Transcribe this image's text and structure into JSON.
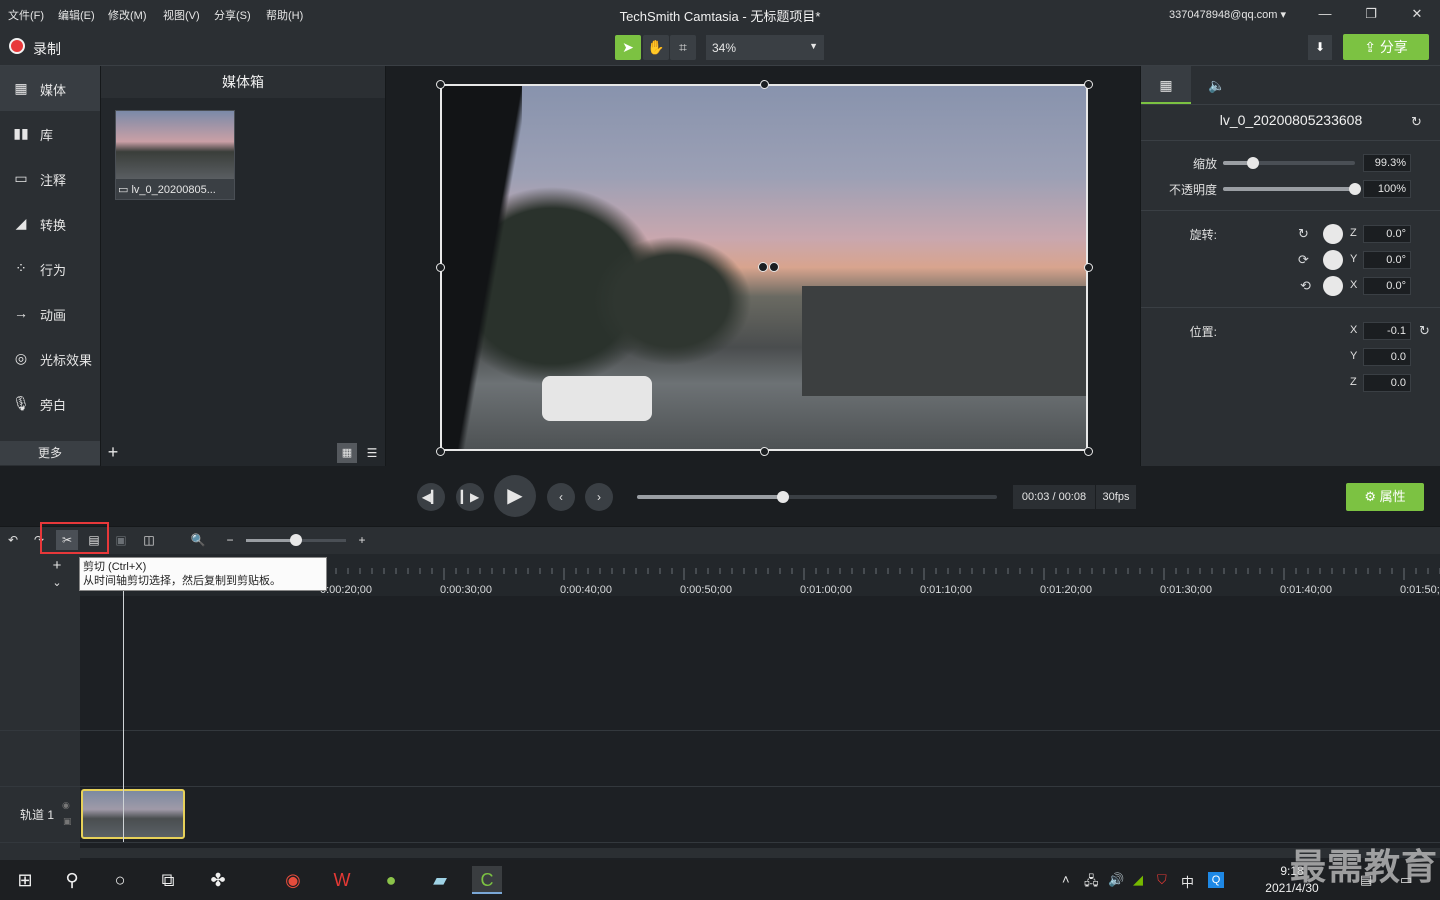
{
  "menu": [
    "文件(F)",
    "编辑(E)",
    "修改(M)",
    "视图(V)",
    "分享(S)",
    "帮助(H)"
  ],
  "window_title": "TechSmith Camtasia - 无标题项目*",
  "account": "3370478948@qq.com ▾",
  "record_label": "录制",
  "zoom_level": "34%",
  "share_label": "分享",
  "nav": [
    "媒体",
    "库",
    "注释",
    "转换",
    "行为",
    "动画",
    "光标效果",
    "旁白"
  ],
  "more_label": "更多",
  "media_bin": {
    "title": "媒体箱",
    "clip_label": "lv_0_20200805..."
  },
  "properties": {
    "clip_name": "lv_0_20200805233608",
    "scale_label": "缩放",
    "scale_value": "99.3%",
    "scale_level": 0.23,
    "opacity_label": "不透明度",
    "opacity_value": "100%",
    "opacity_level": 1.0,
    "rotation_label": "旋转:",
    "rot_z": "0.0°",
    "rot_y": "0.0°",
    "rot_x": "0.0°",
    "position_label": "位置:",
    "pos_x": "-0.1",
    "pos_y": "0.0",
    "pos_z": "0.0"
  },
  "playback": {
    "timecode": "00:03 / 00:08",
    "fps": "30fps",
    "progress": 0.41,
    "properties_label": "属性"
  },
  "tooltip": {
    "title": "剪切 (Ctrl+X)",
    "desc": "从时间轴剪切选择，然后复制到剪贴板。"
  },
  "ruler_ticks": [
    "0:00:20;00",
    "0:00:30;00",
    "0:00:40;00",
    "0:00:50;00",
    "0:01:00;00",
    "0:01:10;00",
    "0:01:20;00",
    "0:01:30;00",
    "0:01:40;00",
    "0:01:50;"
  ],
  "track_label": "轨道 1",
  "clock": {
    "time": "9:18",
    "date": "2021/4/30"
  },
  "tray_ime": "中",
  "watermark": "最需教育",
  "accent_color": "#7cc242"
}
